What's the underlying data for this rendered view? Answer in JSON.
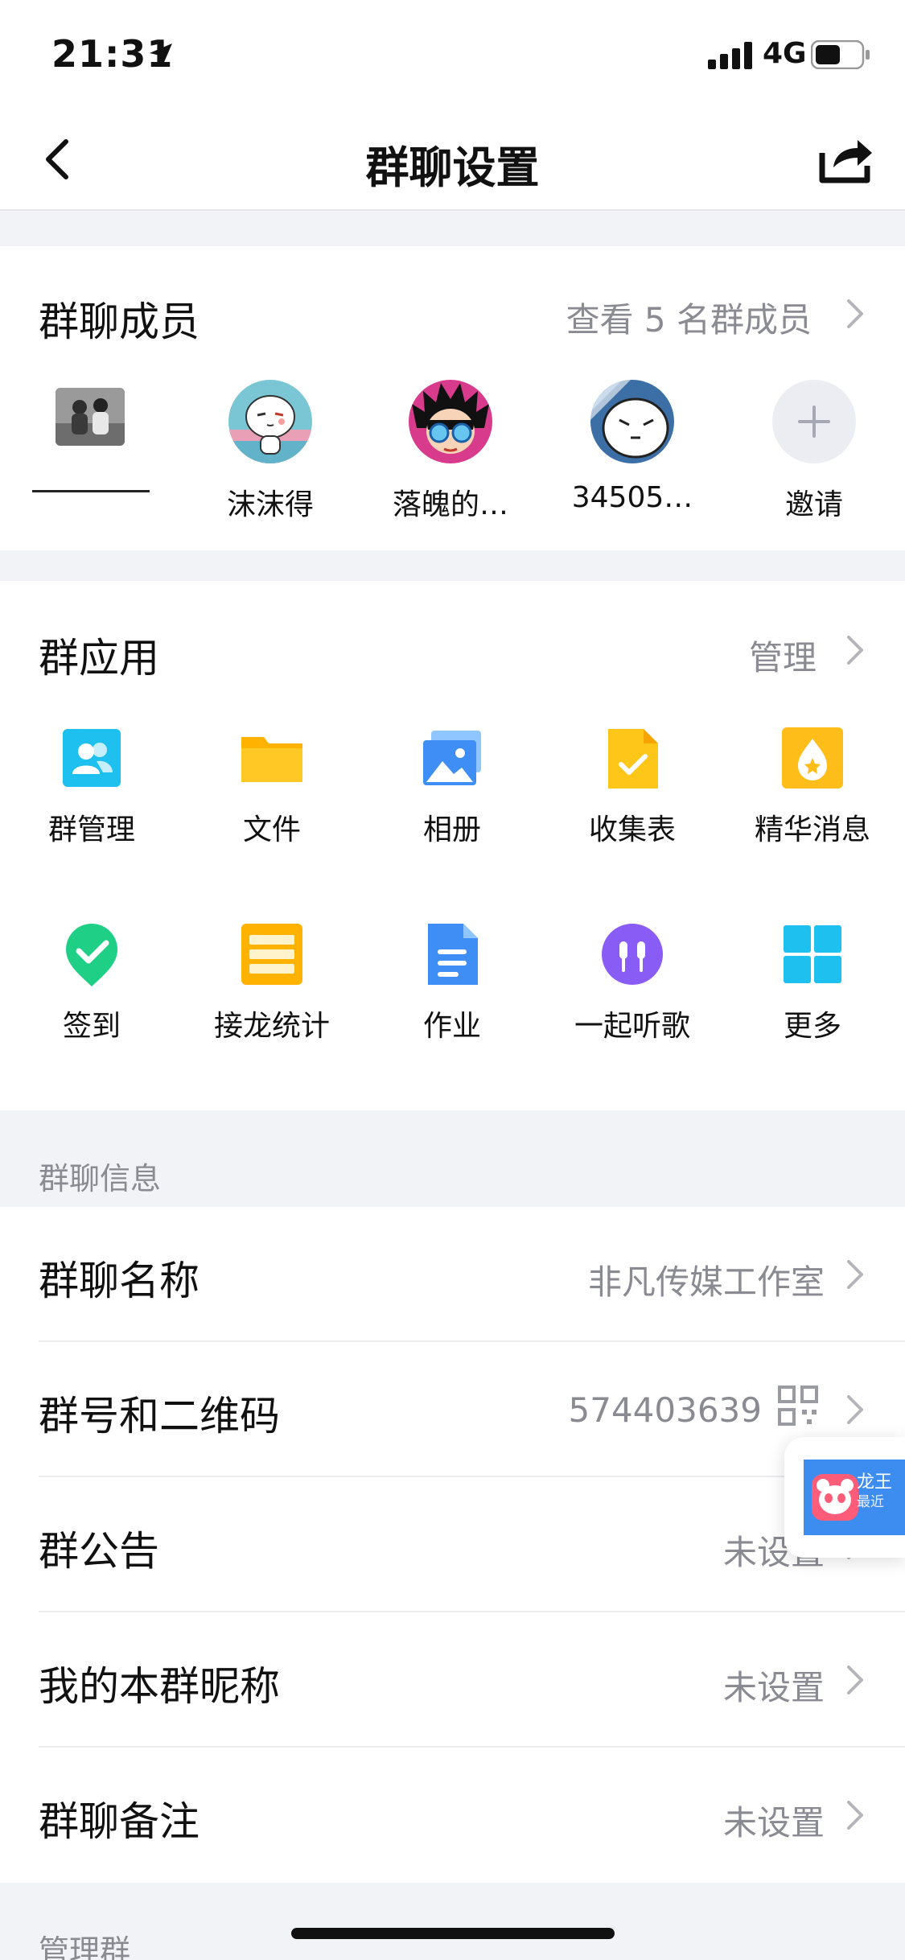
{
  "status_bar": {
    "time": "21:31",
    "network": "4G"
  },
  "nav": {
    "title": "群聊设置"
  },
  "members": {
    "title": "群聊成员",
    "view_all": "查看 5 名群成员",
    "list": [
      {
        "name": ""
      },
      {
        "name": "沫沫得"
      },
      {
        "name": "落魄的…"
      },
      {
        "name": "34505…"
      },
      {
        "name": "邀请"
      }
    ]
  },
  "apps": {
    "title": "群应用",
    "manage": "管理",
    "items": [
      {
        "label": "群管理",
        "icon": "group-manage-icon"
      },
      {
        "label": "文件",
        "icon": "folder-icon"
      },
      {
        "label": "相册",
        "icon": "photo-album-icon"
      },
      {
        "label": "收集表",
        "icon": "form-icon"
      },
      {
        "label": "精华消息",
        "icon": "essence-icon"
      },
      {
        "label": "签到",
        "icon": "check-in-icon"
      },
      {
        "label": "接龙统计",
        "icon": "list-stats-icon"
      },
      {
        "label": "作业",
        "icon": "homework-icon"
      },
      {
        "label": "一起听歌",
        "icon": "headphones-icon"
      },
      {
        "label": "更多",
        "icon": "grid-more-icon"
      }
    ]
  },
  "info": {
    "section_label": "群聊信息",
    "rows": [
      {
        "label": "群聊名称",
        "value": "非凡传媒工作室"
      },
      {
        "label": "群号和二维码",
        "value": "574403639"
      },
      {
        "label": "群公告",
        "value": "未设置"
      },
      {
        "label": "我的本群昵称",
        "value": "未设置"
      },
      {
        "label": "群聊备注",
        "value": "未设置"
      }
    ]
  },
  "manage_section_label": "管理群",
  "floating": {
    "title": "龙王",
    "subtitle": "最近"
  },
  "colors": {
    "accent_blue": "#12b7f5",
    "secondary_text": "#8a8a92",
    "page_bg": "#f2f3f7"
  }
}
